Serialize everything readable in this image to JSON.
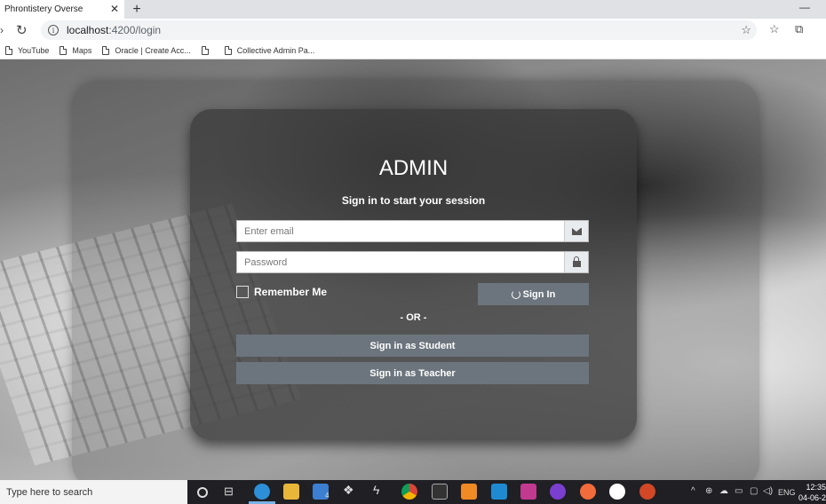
{
  "browser": {
    "tab_title": "Phrontistery Overse",
    "url_host": "localhost",
    "url_path": ":4200/login",
    "bookmarks": [
      "YouTube",
      "Maps",
      "Oracle | Create Acc...",
      "",
      "Collective Admin Pa..."
    ]
  },
  "login": {
    "title": "ADMIN",
    "subtitle": "Sign in to start your session",
    "email_placeholder": "Enter email",
    "password_placeholder": "Password",
    "remember_label": "Remember Me",
    "signin_label": "Sign In",
    "or_label": "- OR -",
    "student_label": "Sign in as Student",
    "teacher_label": "Sign in as Teacher"
  },
  "taskbar": {
    "search_placeholder": "Type here to search",
    "mail_badge": "4",
    "lang": "ENG",
    "time": "12:35",
    "date": "04-06-2"
  },
  "colors": {
    "button": "#6c757d",
    "card": "#373737"
  }
}
